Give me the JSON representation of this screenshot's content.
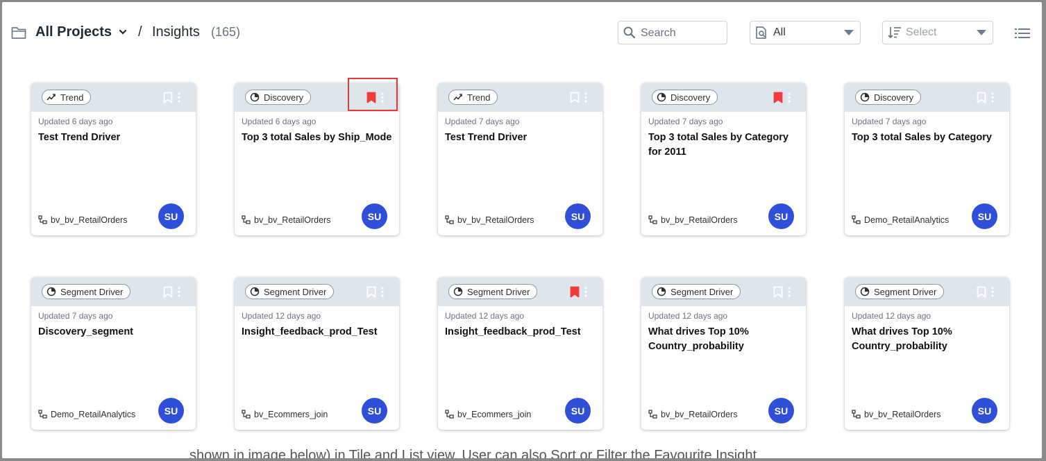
{
  "header": {
    "project_title": "All Projects",
    "separator": "/",
    "section": "Insights",
    "count": "(165)"
  },
  "search": {
    "placeholder": "Search"
  },
  "filter": {
    "value": "All"
  },
  "sort": {
    "placeholder": "Select"
  },
  "avatar_color": "#2f4fd9",
  "bookmark_active_color": "#f23a3a",
  "cards": [
    {
      "type": "Trend",
      "type_icon": "trend-icon",
      "bookmarked": false,
      "updated": "Updated 6 days ago",
      "title": "Test Trend Driver",
      "dataset": "bv_bv_RetailOrders",
      "avatar": "SU"
    },
    {
      "type": "Discovery",
      "type_icon": "discovery-icon",
      "bookmarked": true,
      "updated": "Updated 6 days ago",
      "title": "Top 3 total Sales by Ship_Mode",
      "dataset": "bv_bv_RetailOrders",
      "avatar": "SU"
    },
    {
      "type": "Trend",
      "type_icon": "trend-icon",
      "bookmarked": false,
      "updated": "Updated 7 days ago",
      "title": "Test Trend Driver",
      "dataset": "bv_bv_RetailOrders",
      "avatar": "SU"
    },
    {
      "type": "Discovery",
      "type_icon": "discovery-icon",
      "bookmarked": true,
      "updated": "Updated 7 days ago",
      "title": "Top 3 total Sales by Category for 2011",
      "dataset": "bv_bv_RetailOrders",
      "avatar": "SU"
    },
    {
      "type": "Discovery",
      "type_icon": "discovery-icon",
      "bookmarked": false,
      "updated": "Updated 7 days ago",
      "title": "Top 3 total Sales by Category",
      "dataset": "Demo_RetailAnalytics",
      "avatar": "SU"
    },
    {
      "type": "Segment Driver",
      "type_icon": "segment-icon",
      "bookmarked": false,
      "updated": "Updated 7 days ago",
      "title": "Discovery_segment",
      "dataset": "Demo_RetailAnalytics",
      "avatar": "SU"
    },
    {
      "type": "Segment Driver",
      "type_icon": "segment-icon",
      "bookmarked": false,
      "updated": "Updated 12 days ago",
      "title": "Insight_feedback_prod_Test",
      "dataset": "bv_Ecommers_join",
      "avatar": "SU"
    },
    {
      "type": "Segment Driver",
      "type_icon": "segment-icon",
      "bookmarked": true,
      "updated": "Updated 12 days ago",
      "title": "Insight_feedback_prod_Test",
      "dataset": "bv_Ecommers_join",
      "avatar": "SU"
    },
    {
      "type": "Segment Driver",
      "type_icon": "segment-icon",
      "bookmarked": false,
      "updated": "Updated 12 days ago",
      "title": "What drives Top 10% Country_probability",
      "dataset": "bv_bv_RetailOrders",
      "avatar": "SU"
    },
    {
      "type": "Segment Driver",
      "type_icon": "segment-icon",
      "bookmarked": false,
      "updated": "Updated 12 days ago",
      "title": "What drives Top 10% Country_probability",
      "dataset": "bv_bv_RetailOrders",
      "avatar": "SU"
    }
  ],
  "footer_text": "shown in image below) in Tile and List view. User can also Sort or Filter the Favourite Insight,"
}
